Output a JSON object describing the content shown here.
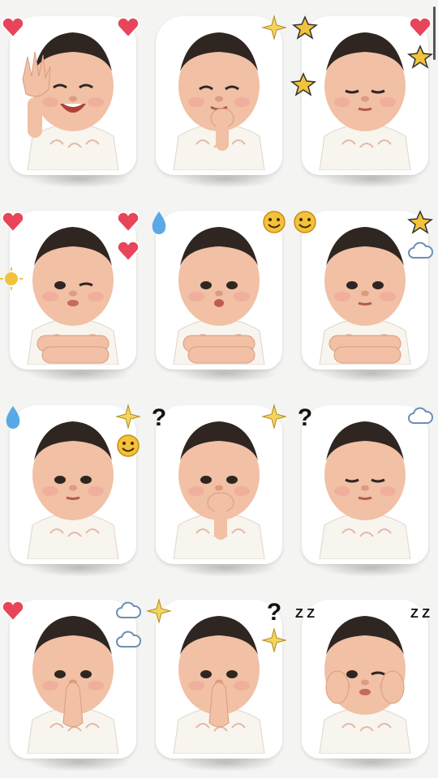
{
  "colors": {
    "background": "#f4f4f2",
    "sticker_border": "#ffffff",
    "skin": "#f1c0a5",
    "hair": "#2f2622",
    "onesie": "#f8f5ee",
    "heart": "#e8445a",
    "star": "#f2c23a",
    "blue": "#5aa9e6",
    "text_dark": "#111111"
  },
  "stickers": [
    {
      "expression": "laughing-wink",
      "pose": "waving",
      "decor": [
        "heart-icon",
        "heart-icon"
      ]
    },
    {
      "expression": "happy-squint",
      "pose": "hand-on-chin",
      "decor": [
        "sparkle-icon"
      ]
    },
    {
      "expression": "sleepy",
      "pose": "relaxed",
      "decor": [
        "heart-icon",
        "star-icon",
        "star-icon",
        "star-icon"
      ]
    },
    {
      "expression": "wink",
      "pose": "arms-crossed",
      "decor": [
        "heart-icon",
        "heart-icon",
        "heart-icon",
        "sun-icon"
      ]
    },
    {
      "expression": "pout",
      "pose": "arms-crossed",
      "decor": [
        "smiley-icon",
        "droplet-icon"
      ]
    },
    {
      "expression": "neutral",
      "pose": "arms-crossed",
      "decor": [
        "star-icon",
        "smiley-icon",
        "cloud-icon"
      ]
    },
    {
      "expression": "neutral",
      "pose": "relaxed",
      "decor": [
        "sparkle-icon",
        "droplet-icon",
        "smiley-icon"
      ]
    },
    {
      "expression": "thinking",
      "pose": "hand-on-mouth",
      "decor": [
        "sparkle-icon",
        "question-mark-icon"
      ]
    },
    {
      "expression": "sleepy",
      "pose": "relaxed",
      "decor": [
        "cloud-icon",
        "question-mark-icon"
      ]
    },
    {
      "expression": "neutral",
      "pose": "praying-hands",
      "decor": [
        "cloud-icon",
        "heart-icon",
        "cloud-icon"
      ]
    },
    {
      "expression": "neutral",
      "pose": "praying-hands",
      "decor": [
        "question-mark-icon",
        "sparkle-icon",
        "sparkle-icon"
      ]
    },
    {
      "expression": "wink",
      "pose": "hands-on-cheeks",
      "decor": [
        "zzz-icon",
        "zzz-icon"
      ]
    }
  ],
  "glyphs": {
    "question": "?",
    "zzz": "Z Z"
  }
}
